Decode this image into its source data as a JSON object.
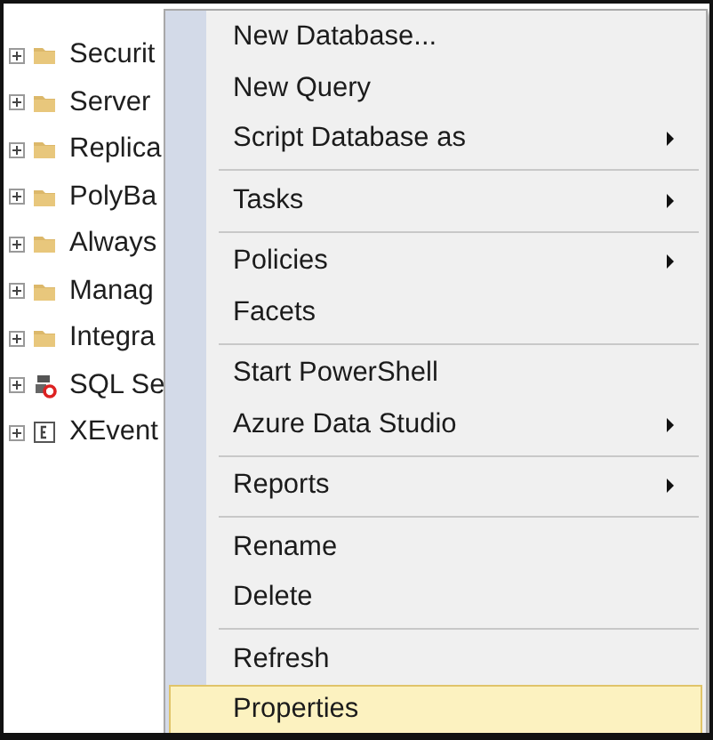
{
  "tree": {
    "items": [
      {
        "label": "Securit",
        "kind": "folder",
        "expanded": false
      },
      {
        "label": "Server",
        "kind": "folder",
        "expanded": false
      },
      {
        "label": "Replica",
        "kind": "folder",
        "expanded": false
      },
      {
        "label": "PolyBa",
        "kind": "folder",
        "expanded": false
      },
      {
        "label": "Always",
        "kind": "folder",
        "expanded": false
      },
      {
        "label": "Manag",
        "kind": "folder",
        "expanded": false
      },
      {
        "label": "Integra",
        "kind": "folder",
        "expanded": false
      },
      {
        "label": "SQL Se",
        "kind": "agent",
        "expanded": false
      },
      {
        "label": "XEvent",
        "kind": "xevent",
        "expanded": false
      }
    ]
  },
  "context_menu": {
    "items": [
      {
        "kind": "item",
        "label": "New Database...",
        "submenu": false,
        "selected": false
      },
      {
        "kind": "item",
        "label": "New Query",
        "submenu": false,
        "selected": false
      },
      {
        "kind": "item",
        "label": "Script Database as",
        "submenu": true,
        "selected": false
      },
      {
        "kind": "separator"
      },
      {
        "kind": "item",
        "label": "Tasks",
        "submenu": true,
        "selected": false
      },
      {
        "kind": "separator"
      },
      {
        "kind": "item",
        "label": "Policies",
        "submenu": true,
        "selected": false
      },
      {
        "kind": "item",
        "label": "Facets",
        "submenu": false,
        "selected": false
      },
      {
        "kind": "separator"
      },
      {
        "kind": "item",
        "label": "Start PowerShell",
        "submenu": false,
        "selected": false
      },
      {
        "kind": "item",
        "label": "Azure Data Studio",
        "submenu": true,
        "selected": false
      },
      {
        "kind": "separator"
      },
      {
        "kind": "item",
        "label": "Reports",
        "submenu": true,
        "selected": false
      },
      {
        "kind": "separator"
      },
      {
        "kind": "item",
        "label": "Rename",
        "submenu": false,
        "selected": false
      },
      {
        "kind": "item",
        "label": "Delete",
        "submenu": false,
        "selected": false
      },
      {
        "kind": "separator"
      },
      {
        "kind": "item",
        "label": "Refresh",
        "submenu": false,
        "selected": false
      },
      {
        "kind": "item",
        "label": "Properties",
        "submenu": false,
        "selected": true
      }
    ]
  }
}
